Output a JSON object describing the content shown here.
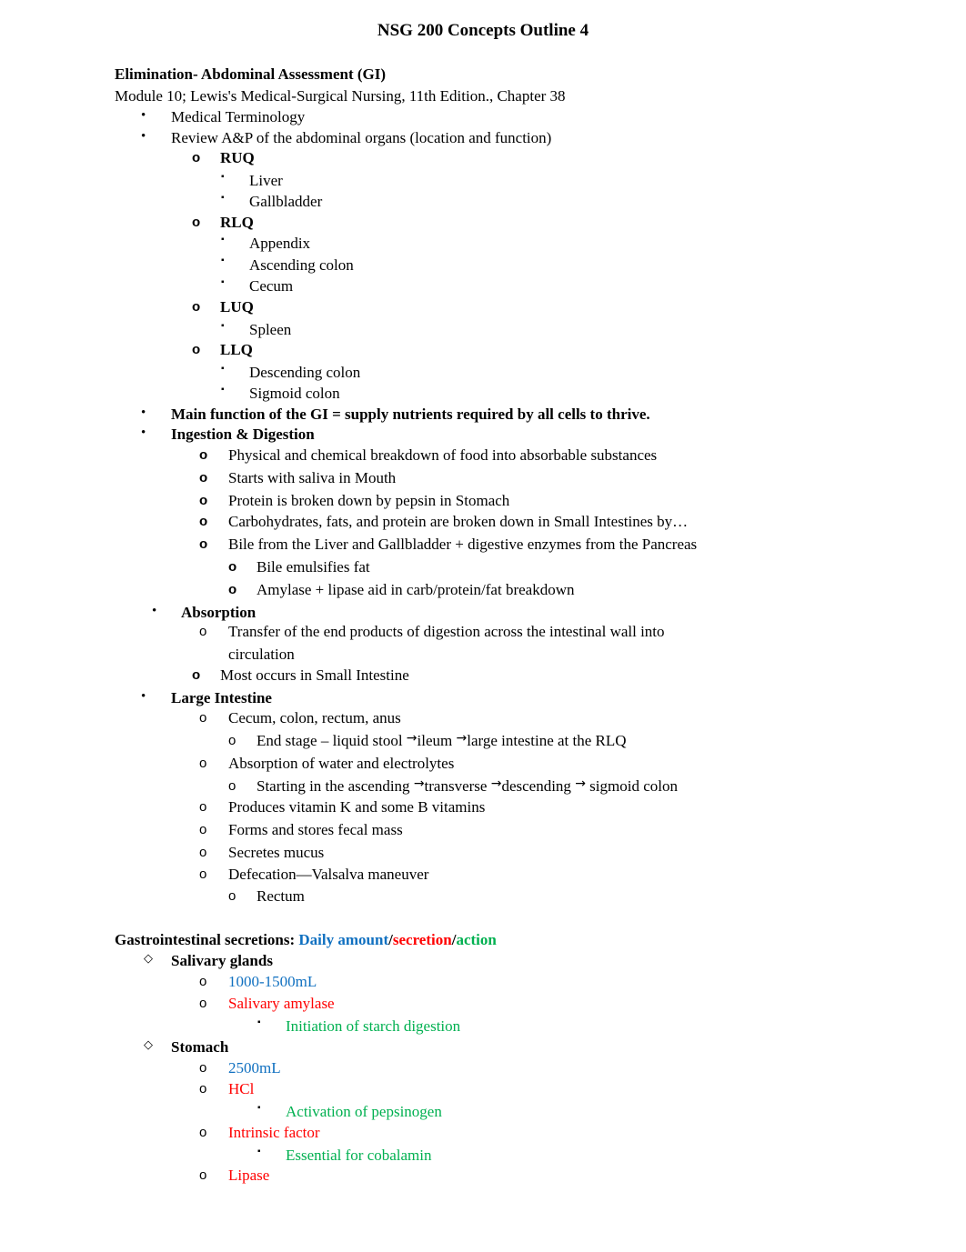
{
  "document": {
    "title": "NSG 200 Concepts Outline 4",
    "section1": {
      "heading": "Elimination- Abdominal Assessment (GI)",
      "reference": "Module 10; Lewis's Medical-Surgical Nursing, 11th Edition., Chapter 38",
      "items": {
        "medical_terminology": "Medical Terminology",
        "review_ap": "Review A&P of the abdominal organs (location and function)",
        "quadrants": [
          {
            "label": "RUQ",
            "organs": [
              "Liver",
              "Gallbladder"
            ]
          },
          {
            "label": "RLQ",
            "organs": [
              "Appendix",
              "Ascending colon",
              "Cecum"
            ]
          },
          {
            "label": "LUQ",
            "organs": [
              "Spleen"
            ]
          },
          {
            "label": "LLQ",
            "organs": [
              "Descending colon",
              "Sigmoid colon"
            ]
          }
        ],
        "main_function": "Main function of the GI = supply nutrients required by all cells to thrive.",
        "ingestion": {
          "heading": "Ingestion & Digestion",
          "points": [
            "Physical and chemical breakdown of food into absorbable substances",
            "Starts with saliva in Mouth",
            "Protein is broken down by pepsin in Stomach",
            "Carbohydrates, fats, and protein are broken down in Small Intestines by…",
            "Bile from the Liver and Gallbladder + digestive enzymes from the Pancreas"
          ],
          "subpoints": [
            "Bile emulsifies fat",
            "Amylase + lipase aid in carb/protein/fat breakdown"
          ]
        },
        "absorption": {
          "heading": "Absorption",
          "point1_line1": "Transfer of the end products of digestion across the intestinal wall into",
          "point1_line2": "circulation",
          "point2": "Most occurs in Small Intestine"
        },
        "large_intestine": {
          "heading": "Large Intestine",
          "point_parts": "Cecum, colon, rectum, anus",
          "end_stage": {
            "a": "End stage – liquid stool ",
            "b": "ileum ",
            "c": "large intestine at the RLQ"
          },
          "point_absorption": "Absorption of water and electrolytes",
          "starting": {
            "a": "Starting in the ascending ",
            "b": "transverse ",
            "c": "descending ",
            "d": " sigmoid colon"
          },
          "arrow": "→",
          "point_vitamins": "Produces vitamin K and some B vitamins",
          "point_fecal": "Forms and stores fecal mass",
          "point_mucus": "Secretes mucus",
          "point_defecation": "Defecation—Valsalva maneuver",
          "sub_rectum": "Rectum"
        }
      }
    },
    "section2": {
      "heading_prefix": "Gastrointestinal secretions: ",
      "legend_amount": "Daily amount",
      "legend_sep": "/",
      "legend_secretion": "secretion",
      "legend_action": "action",
      "colors": {
        "amount": "#1070c0",
        "secretion": "#ff0000",
        "action": "#00b050"
      },
      "salivary": {
        "heading": "Salivary glands",
        "amount": "1000-1500mL",
        "secretion": "Salivary amylase",
        "action": "Initiation of starch digestion"
      },
      "stomach": {
        "heading": "Stomach",
        "amount": "2500mL",
        "secretion1": "HCl",
        "action1": "Activation of pepsinogen",
        "secretion2": "Intrinsic factor",
        "action2": "Essential for cobalamin",
        "secretion3": "Lipase"
      }
    },
    "markers": {
      "bullet": "•",
      "circle": "o",
      "square": "▪",
      "diamond": "◇"
    }
  }
}
